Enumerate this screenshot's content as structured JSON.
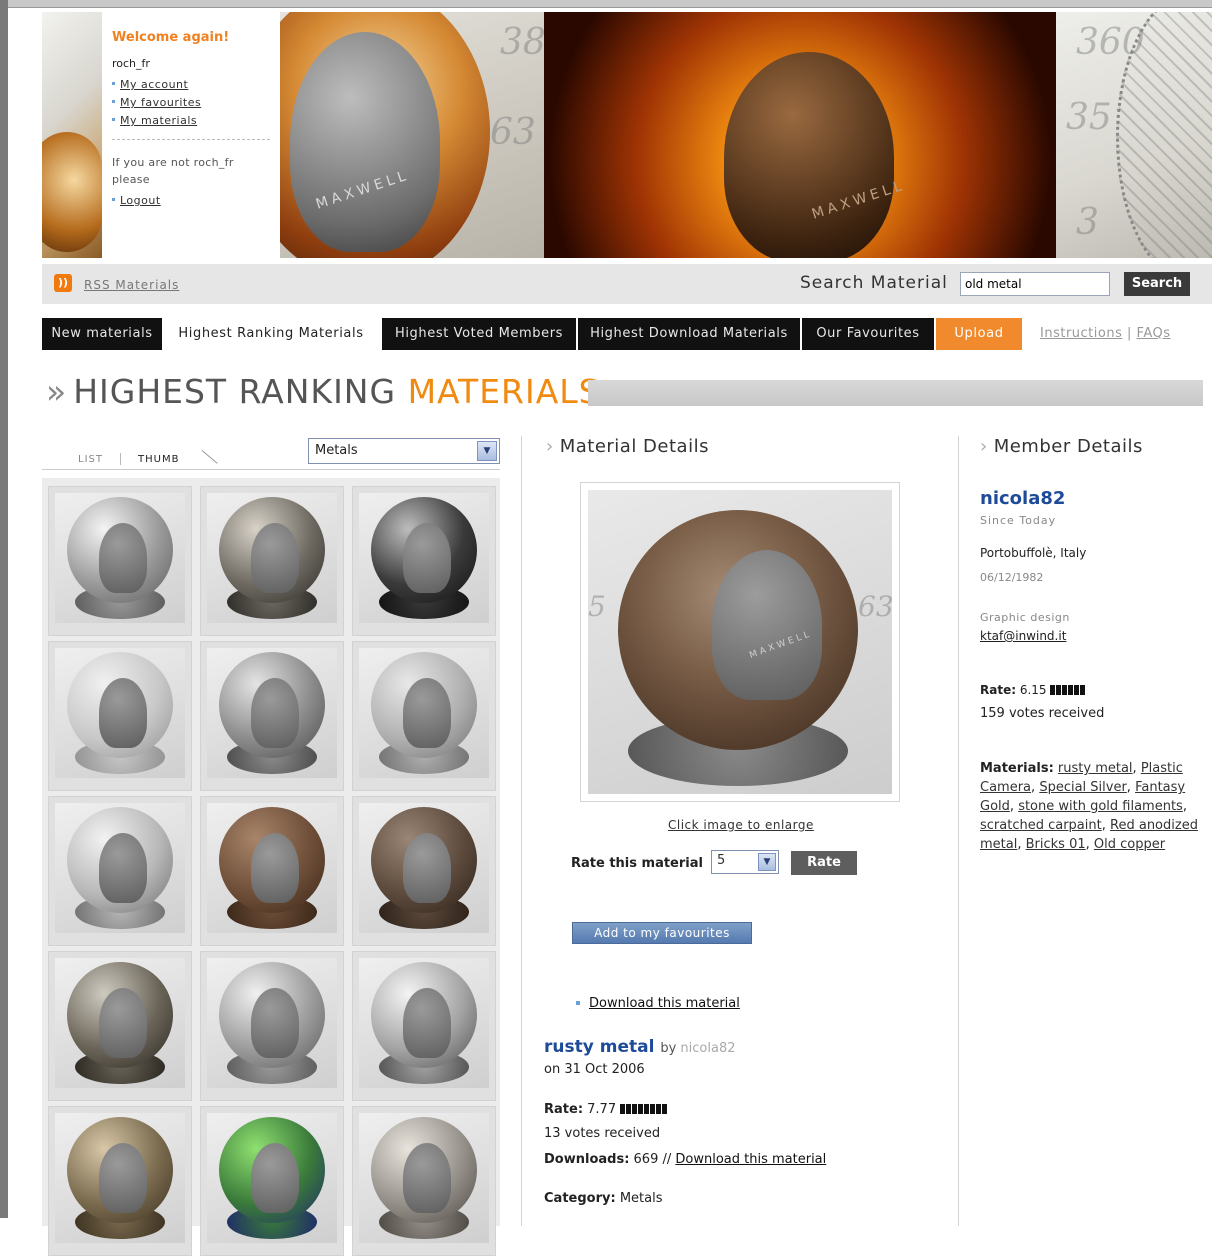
{
  "header": {
    "welcome_title": "Welcome again!",
    "username": "roch_fr",
    "links": [
      "My account",
      "My favourites",
      "My materials"
    ],
    "note": "If you are not roch_fr please",
    "logout": "Logout",
    "hero_brand": "MAXWELL"
  },
  "toolbar": {
    "rss_label": "RSS Materials",
    "search_label": "Search Material",
    "search_value": "old metal",
    "search_button": "Search"
  },
  "nav": {
    "tabs": [
      {
        "label": "New materials",
        "style": "dark"
      },
      {
        "label": "Highest Ranking Materials",
        "style": "active"
      },
      {
        "label": "Highest Voted Members",
        "style": "dark"
      },
      {
        "label": "Highest Download Materials",
        "style": "dark"
      },
      {
        "label": "Our Favourites",
        "style": "dark"
      },
      {
        "label": "Upload",
        "style": "orange"
      }
    ],
    "instructions": "Instructions",
    "separator": "|",
    "faqs": "FAQs"
  },
  "page_title": {
    "arrows": "»",
    "main": "HIGHEST RANKING ",
    "accent": "MATERIALS"
  },
  "browser": {
    "view_list": "LIST",
    "view_thumb": "THUMB",
    "category": "Metals",
    "thumbnails": [
      {
        "ball": "chrome"
      },
      {
        "ball": "perforated"
      },
      {
        "ball": "dark-chrome"
      },
      {
        "ball": "wire"
      },
      {
        "ball": "brushed"
      },
      {
        "ball": "hex-mesh"
      },
      {
        "ball": "hammered"
      },
      {
        "ball": "rusty"
      },
      {
        "ball": "old-iron"
      },
      {
        "ball": "weathered"
      },
      {
        "ball": "dotted"
      },
      {
        "ball": "steel"
      },
      {
        "ball": "stained"
      },
      {
        "ball": "green-pattern"
      },
      {
        "ball": "worn-silver"
      }
    ]
  },
  "material": {
    "heading": "Material Details",
    "enlarge": "Click image to enlarge",
    "rate_label": "Rate this material",
    "rate_value": "5",
    "rate_button": "Rate",
    "favourite_button": "Add to my favourites",
    "download_link": "Download this material",
    "name": "rusty metal",
    "by": "by",
    "author": "nicola82",
    "date": "on 31 Oct 2006",
    "rate_key": "Rate:",
    "rate": "7.77",
    "rate_fraction": 0.777,
    "votes": "13 votes received",
    "downloads_key": "Downloads:",
    "downloads": "669 //",
    "downloads_link": "Download this material",
    "category_key": "Category:",
    "category": "Metals"
  },
  "member": {
    "heading": "Member Details",
    "name": "nicola82",
    "since": "Since Today",
    "location": "Portobuffolè, Italy",
    "dob": "06/12/1982",
    "job": "Graphic design",
    "email": "ktaf@inwind.it",
    "rate_key": "Rate:",
    "rate": "6.15",
    "rate_fraction": 0.615,
    "votes": "159 votes received",
    "materials_key": "Materials:",
    "materials": [
      "rusty metal",
      "Plastic Camera",
      "Special Silver",
      "Fantasy Gold",
      "stone with gold filaments",
      "scratched carpaint",
      "Red anodized metal",
      "Bricks 01",
      "Old copper"
    ]
  },
  "colors": {
    "accent_orange": "#f08a10",
    "link_blue": "#1d4b9a",
    "dark_nav": "#111111"
  }
}
